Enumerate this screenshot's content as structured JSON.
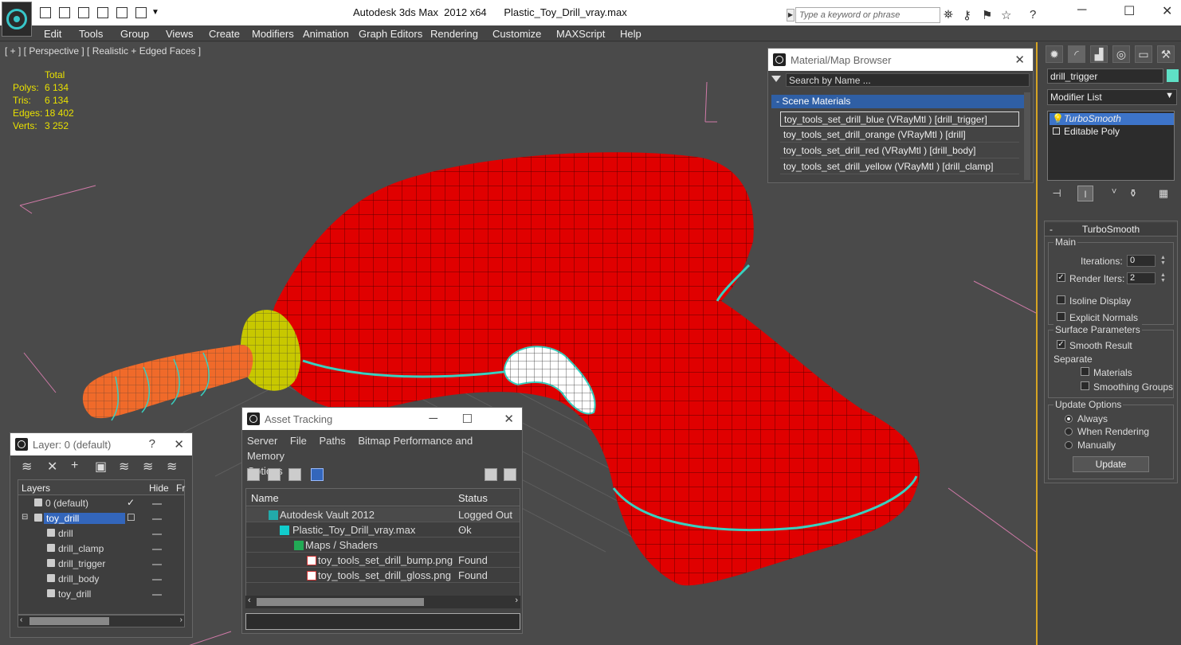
{
  "titlebar": {
    "app": "Autodesk 3ds Max  2012 x64",
    "file": "Plastic_Toy_Drill_vray.max",
    "search_placeholder": "Type a keyword or phrase"
  },
  "menu": [
    "Edit",
    "Tools",
    "Group",
    "Views",
    "Create",
    "Modifiers",
    "Animation",
    "Graph Editors",
    "Rendering",
    "Customize",
    "MAXScript",
    "Help"
  ],
  "viewport": {
    "label": "[ + ] [ Perspective ] [ Realistic + Edged Faces ]",
    "stats_header": "Total",
    "stats": [
      {
        "k": "Polys:",
        "v": "6 134"
      },
      {
        "k": "Tris:",
        "v": "6 134"
      },
      {
        "k": "Edges:",
        "v": "18 402"
      },
      {
        "k": "Verts:",
        "v": "3 252"
      }
    ]
  },
  "material_browser": {
    "title": "Material/Map Browser",
    "search": "Search by Name ...",
    "group": "Scene Materials",
    "group_toggle": "-",
    "items": [
      "toy_tools_set_drill_blue (VRayMtl ) [drill_trigger]",
      "toy_tools_set_drill_orange (VRayMtl ) [drill]",
      "toy_tools_set_drill_red (VRayMtl ) [drill_body]",
      "toy_tools_set_drill_yellow (VRayMtl ) [drill_clamp]"
    ]
  },
  "layer_window": {
    "title": "Layer: 0 (default)",
    "help": "?",
    "columns": [
      "Layers",
      "Hide",
      "Fr"
    ],
    "rows": [
      {
        "name": "0 (default)",
        "level": 1
      },
      {
        "name": "toy_drill",
        "level": 1
      },
      {
        "name": "drill",
        "level": 2
      },
      {
        "name": "drill_clamp",
        "level": 2
      },
      {
        "name": "drill_trigger",
        "level": 2
      },
      {
        "name": "drill_body",
        "level": 2
      },
      {
        "name": "toy_drill",
        "level": 2
      }
    ]
  },
  "asset_tracking": {
    "title": "Asset Tracking",
    "menu": [
      "Server",
      "File",
      "Paths",
      "Bitmap Performance and Memory",
      "Options"
    ],
    "columns": [
      "Name",
      "Status"
    ],
    "rows": [
      {
        "name": "Autodesk Vault 2012",
        "status": "Logged Out ...",
        "icon": "vault"
      },
      {
        "name": "Plastic_Toy_Drill_vray.max",
        "status": "Ok",
        "icon": "max"
      },
      {
        "name": "Maps / Shaders",
        "status": "",
        "icon": "maps"
      },
      {
        "name": "toy_tools_set_drill_bump.png",
        "status": "Found",
        "icon": "png"
      },
      {
        "name": "toy_tools_set_drill_gloss.png",
        "status": "Found",
        "icon": "png"
      }
    ]
  },
  "command_panel": {
    "object_name": "drill_trigger",
    "object_color": "#5fe0c6",
    "modifier_list": "Modifier List",
    "stack": [
      "TurboSmooth",
      "Editable Poly"
    ],
    "rollout": {
      "title": "TurboSmooth",
      "toggle": "-",
      "main_label": "Main",
      "iterations_label": "Iterations:",
      "iterations": "0",
      "render_iters_label": "Render Iters:",
      "render_iters": "2",
      "isoline": "Isoline Display",
      "explicit": "Explicit Normals",
      "surface_label": "Surface Parameters",
      "smooth_result": "Smooth Result",
      "separate": "Separate",
      "materials": "Materials",
      "smoothing_groups": "Smoothing Groups",
      "update_options": "Update Options",
      "always": "Always",
      "when_rendering": "When Rendering",
      "manually": "Manually",
      "update_btn": "Update"
    }
  },
  "colors": {
    "drill_body": "#e00000",
    "drill_clamp": "#c8c800",
    "drill_bit": "#f06a2a",
    "trigger": "#ffffff",
    "wire": "#38d0c0",
    "accent": "#d6a423"
  }
}
